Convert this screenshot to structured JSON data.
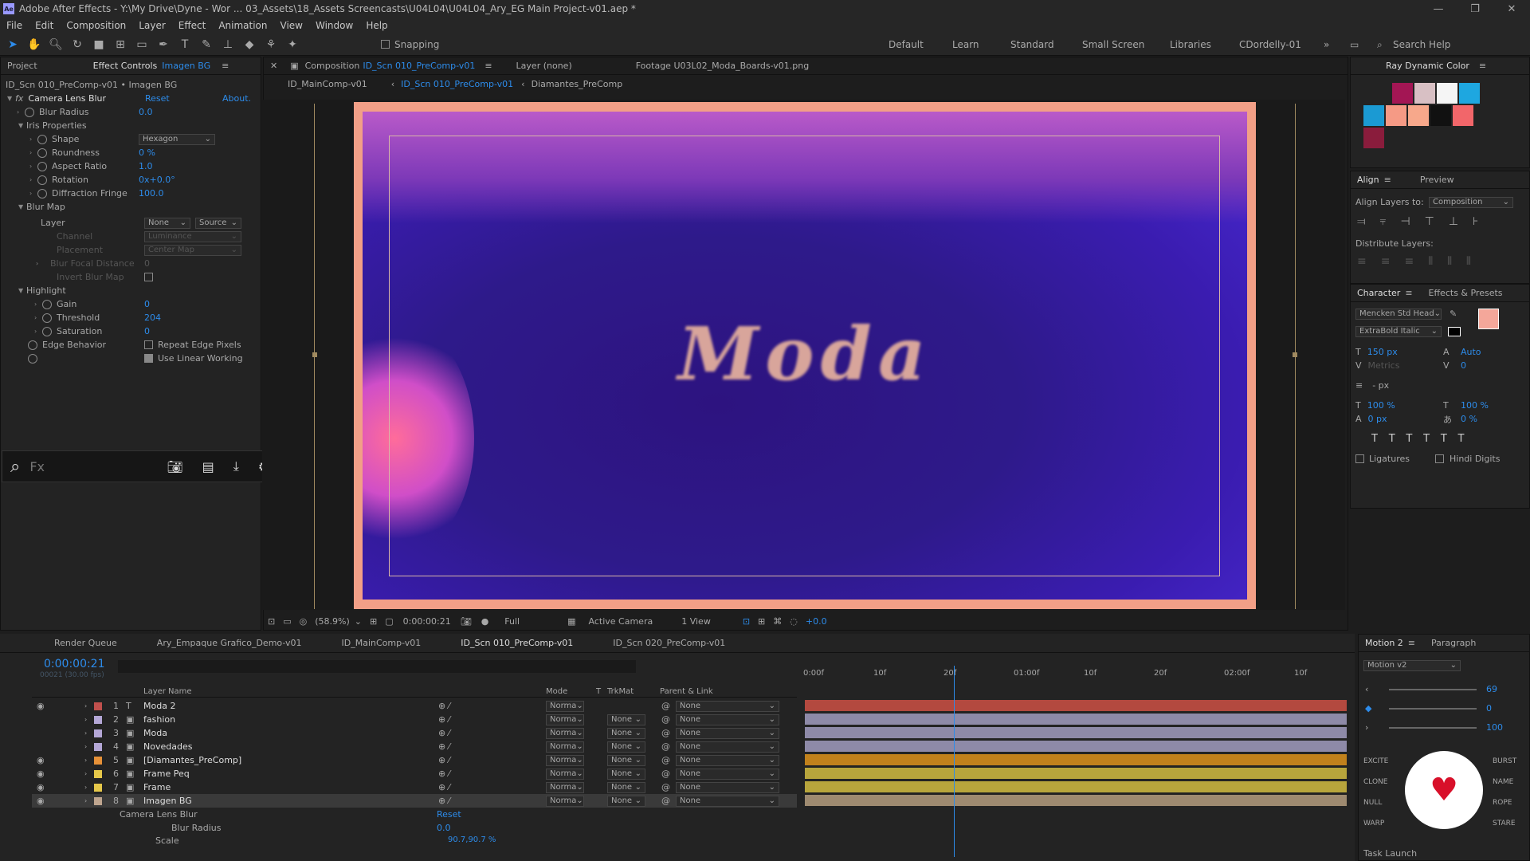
{
  "app": {
    "title": "Adobe After Effects - Y:\\My Drive\\Dyne - Wor ... 03_Assets\\18_Assets Screencasts\\U04L04\\U04L04_Ary_EG Main Project-v01.aep *",
    "logo": "Ae"
  },
  "menu": [
    "File",
    "Edit",
    "Composition",
    "Layer",
    "Effect",
    "Animation",
    "View",
    "Window",
    "Help"
  ],
  "toolbar": {
    "snapping": "Snapping",
    "workspaces": [
      "Default",
      "Learn",
      "Standard",
      "Small Screen",
      "Libraries",
      "CDordelly-01"
    ],
    "search_help": "Search Help"
  },
  "effect_panel": {
    "tab_project": "Project",
    "tab_effect_controls": "Effect Controls",
    "tab_target": "Imagen BG",
    "breadcrumb": "ID_Scn 010_PreComp-v01 • Imagen BG",
    "effect_name": "Camera Lens Blur",
    "reset": "Reset",
    "about": "About.",
    "fx": "fx",
    "props": [
      {
        "label": "Blur Radius",
        "value": "0.0",
        "indent": 1
      },
      {
        "label": "Iris Properties",
        "value": "",
        "indent": 0,
        "group": true
      },
      {
        "label": "Shape",
        "value": "Hexagon",
        "indent": 2,
        "dropdown": true
      },
      {
        "label": "Roundness",
        "value": "0 %",
        "indent": 2
      },
      {
        "label": "Aspect Ratio",
        "value": "1.0",
        "indent": 2
      },
      {
        "label": "Rotation",
        "value": "0x+0.0°",
        "indent": 2
      },
      {
        "label": "Diffraction Fringe",
        "value": "100.0",
        "indent": 2
      },
      {
        "label": "Blur Map",
        "value": "",
        "indent": 0,
        "group": true
      }
    ],
    "blur_map": {
      "layer_label": "Layer",
      "layer_value": "None",
      "source_value": "Source",
      "channel": "Channel",
      "channel_value": "Luminance",
      "placement": "Placement",
      "placement_value": "Center Map",
      "focal": "Blur Focal Distance",
      "focal_value": "0",
      "invert": "Invert Blur Map"
    },
    "highlight": {
      "label": "Highlight",
      "gain": "Gain",
      "gain_value": "0",
      "threshold": "Threshold",
      "threshold_value": "204",
      "saturation": "Saturation",
      "saturation_value": "0"
    },
    "edge_behavior": "Edge Behavior",
    "repeat_edge": "Repeat Edge Pixels",
    "linear": "Use Linear Working"
  },
  "search_bar": {
    "placeholder": "Fx"
  },
  "comp": {
    "tab_comp": "Composition",
    "tab_comp_name": "ID_Scn 010_PreComp-v01",
    "tab_layer": "Layer (none)",
    "tab_footage": "Footage  U03L02_Moda_Boards-v01.png",
    "crumbs": [
      "ID_MainComp-v01",
      "ID_Scn 010_PreComp-v01",
      "Diamantes_PreComp"
    ],
    "artwork_text": "Moda",
    "zoom": "(58.9%)",
    "time": "0:00:00:21",
    "resolution": "Full",
    "camera": "Active Camera",
    "views": "1 View",
    "exposure": "+0.0"
  },
  "right_panel": {
    "color_title": "Ray Dynamic Color",
    "swatches": [
      "#a31654",
      "#d8c0c4",
      "#f5f5f5",
      "#1ea7e0",
      "#1b9ad3",
      "#f59a85",
      "#f7a88b",
      "#111111",
      "#f2666a",
      "#8a1c3c"
    ],
    "align_tab": "Align",
    "preview_tab": "Preview",
    "align_to_label": "Align Layers to:",
    "align_to": "Composition",
    "distribute": "Distribute Layers:",
    "character_tab": "Character",
    "effects_tab": "Effects & Presets",
    "font": "Mencken Std Head",
    "style": "ExtraBold Italic",
    "size": "150 px",
    "leading": "Auto",
    "kerning": "Metrics",
    "tracking": "0",
    "line": "- px",
    "vscale": "100 %",
    "hscale": "100 %",
    "baseline": "0 px",
    "tsume": "0 %",
    "ligatures": "Ligatures",
    "hindi": "Hindi Digits",
    "fill_color": "#f4a79a"
  },
  "motion": {
    "tab": "Motion 2",
    "tab2": "Paragraph",
    "version": "Motion v2",
    "slider1": "69",
    "slider2": "0",
    "slider3": "100",
    "buttons_left": [
      "EXCITE",
      "CLONE",
      "NULL",
      "WARP"
    ],
    "buttons_right": [
      "BURST",
      "NAME",
      "ROPE",
      "STARE"
    ],
    "task": "Task Launch"
  },
  "timeline": {
    "tabs": [
      "Render Queue",
      "Ary_Empaque Grafico_Demo-v01",
      "ID_MainComp-v01",
      "ID_Scn 010_PreComp-v01",
      "ID_Scn 020_PreComp-v01"
    ],
    "timecode": "0:00:00:21",
    "fps": "00021 (30.00 fps)",
    "header": {
      "name": "Layer Name",
      "mode": "Mode",
      "t": "T",
      "trkmat": "TrkMat",
      "parent": "Parent & Link"
    },
    "ruler": [
      "0:00f",
      "10f",
      "20f",
      "01:00f",
      "10f",
      "20f",
      "02:00f",
      "10f"
    ],
    "layers": [
      {
        "num": "1",
        "name": "Moda 2",
        "type": "T",
        "color": "#c0504d",
        "mode": "Norma",
        "trk": "",
        "parent": "None",
        "bar": "#b3493f"
      },
      {
        "num": "2",
        "name": "fashion",
        "type": "img",
        "color": "#b4a7d6",
        "mode": "Norma",
        "trk": "None",
        "parent": "None",
        "bar": "#8e8aa8"
      },
      {
        "num": "3",
        "name": "Moda",
        "type": "img",
        "color": "#b4a7d6",
        "mode": "Norma",
        "trk": "None",
        "parent": "None",
        "bar": "#8e8aa8"
      },
      {
        "num": "4",
        "name": "Novedades",
        "type": "img",
        "color": "#b4a7d6",
        "mode": "Norma",
        "trk": "None",
        "parent": "None",
        "bar": "#8e8aa8"
      },
      {
        "num": "5",
        "name": "[Diamantes_PreComp]",
        "type": "comp",
        "color": "#e69138",
        "mode": "Norma",
        "trk": "None",
        "parent": "None",
        "bar": "#c1811c"
      },
      {
        "num": "6",
        "name": "Frame Peq",
        "type": "img",
        "color": "#e6c84a",
        "mode": "Norma",
        "trk": "None",
        "parent": "None",
        "bar": "#b8a53c"
      },
      {
        "num": "7",
        "name": "Frame",
        "type": "img",
        "color": "#e6c84a",
        "mode": "Norma",
        "trk": "None",
        "parent": "None",
        "bar": "#b8a53c"
      },
      {
        "num": "8",
        "name": "Imagen BG",
        "type": "img",
        "color": "#bfa58f",
        "mode": "Norma",
        "trk": "None",
        "parent": "None",
        "bar": "#9e8a70"
      }
    ],
    "sub_effect": "Camera Lens Blur",
    "sub_reset": "Reset",
    "sub_prop": "Blur Radius",
    "sub_value": "0.0",
    "scale_label": "Scale",
    "scale_value": "90.7,90.7 %"
  }
}
